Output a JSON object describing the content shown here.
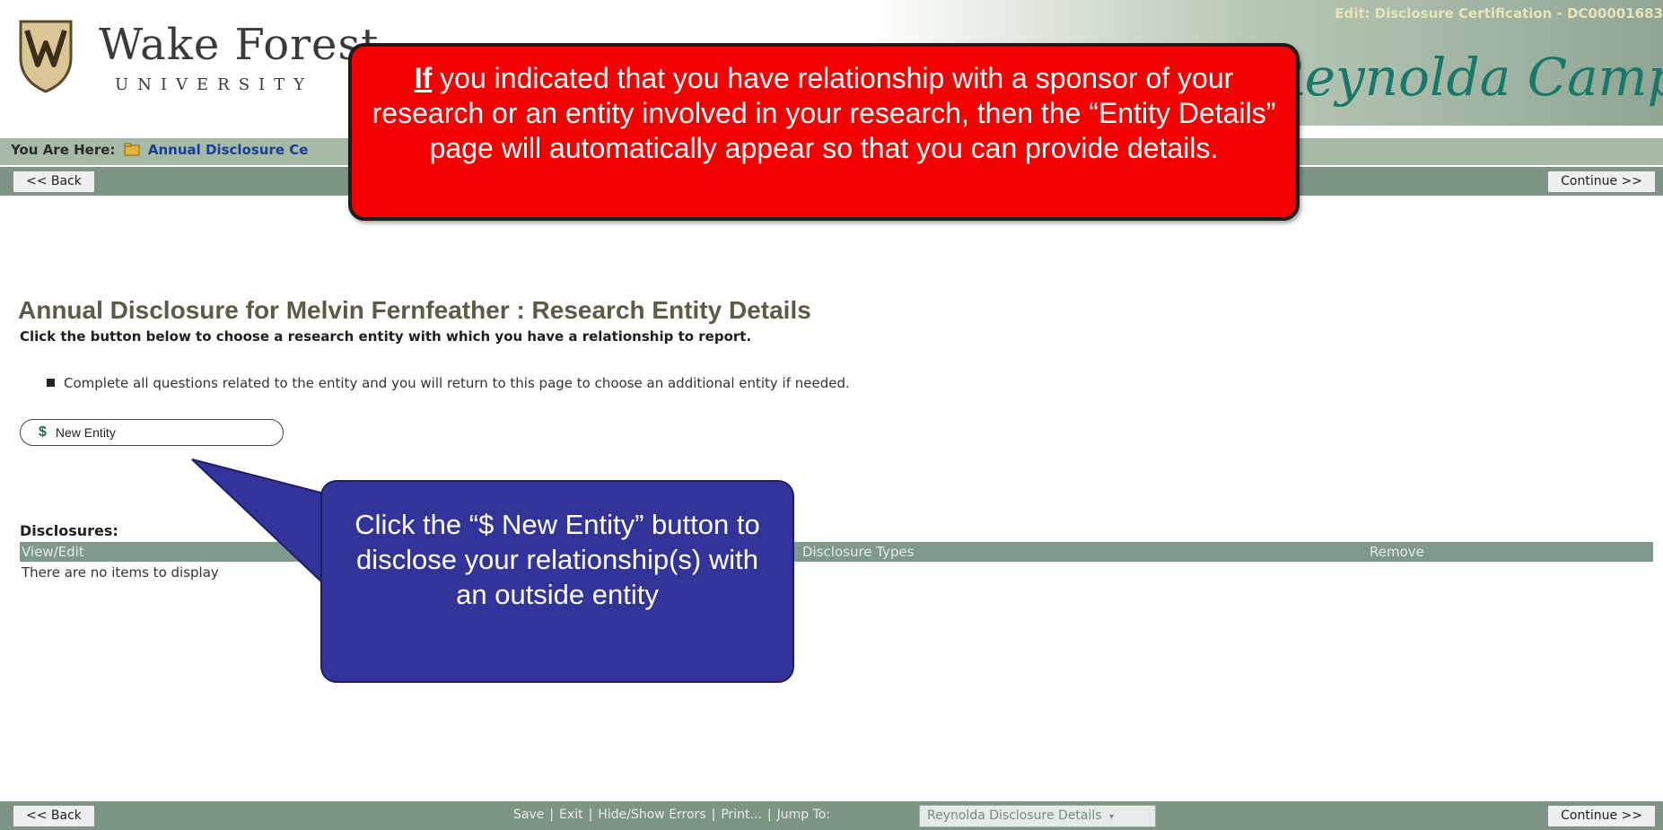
{
  "header": {
    "university_name": "Wake Forest",
    "university_sub": "UNIVERSITY",
    "campus": "Reynolda Campus",
    "edit_title": "Edit: Disclosure Certification - DC00001683"
  },
  "breadcrumb": {
    "prefix": "You Are Here:",
    "link": "Annual Disclosure Ce"
  },
  "nav": {
    "back_label": "<< Back",
    "continue_label": "Continue >>"
  },
  "content": {
    "page_title": "Annual Disclosure for Melvin Fernfeather : Research Entity Details",
    "instruction": "Click the button below to choose a research entity with which you have a relationship to report.",
    "bullet": "Complete all questions related to the entity and you will return to this page to choose an additional entity if needed.",
    "new_entity_icon": "$",
    "new_entity_label": "New Entity"
  },
  "disclosures": {
    "label": "Disclosures:",
    "columns": [
      "View/Edit",
      "Disclosure Types",
      "Remove"
    ],
    "empty_text": "There are no items to display"
  },
  "footer": {
    "save": "Save",
    "exit": "Exit",
    "hide_show": "Hide/Show Errors",
    "print": "Print...",
    "jump_to": "Jump To:",
    "jump_value": "Reynolda Disclosure Details"
  },
  "callouts": {
    "red_if": "If",
    "red_text": " you indicated that you have relationship with a sponsor of your research or an entity involved in your research, then the “Entity Details” page will automatically appear so that you can provide details.",
    "blue_text": "Click the “$ New Entity” button  to disclose your relationship(s) with an outside entity"
  },
  "colors": {
    "callout_red": "#f50000",
    "callout_blue": "#33349a",
    "nav_green": "#7c9585",
    "campus_teal": "#18796b"
  }
}
